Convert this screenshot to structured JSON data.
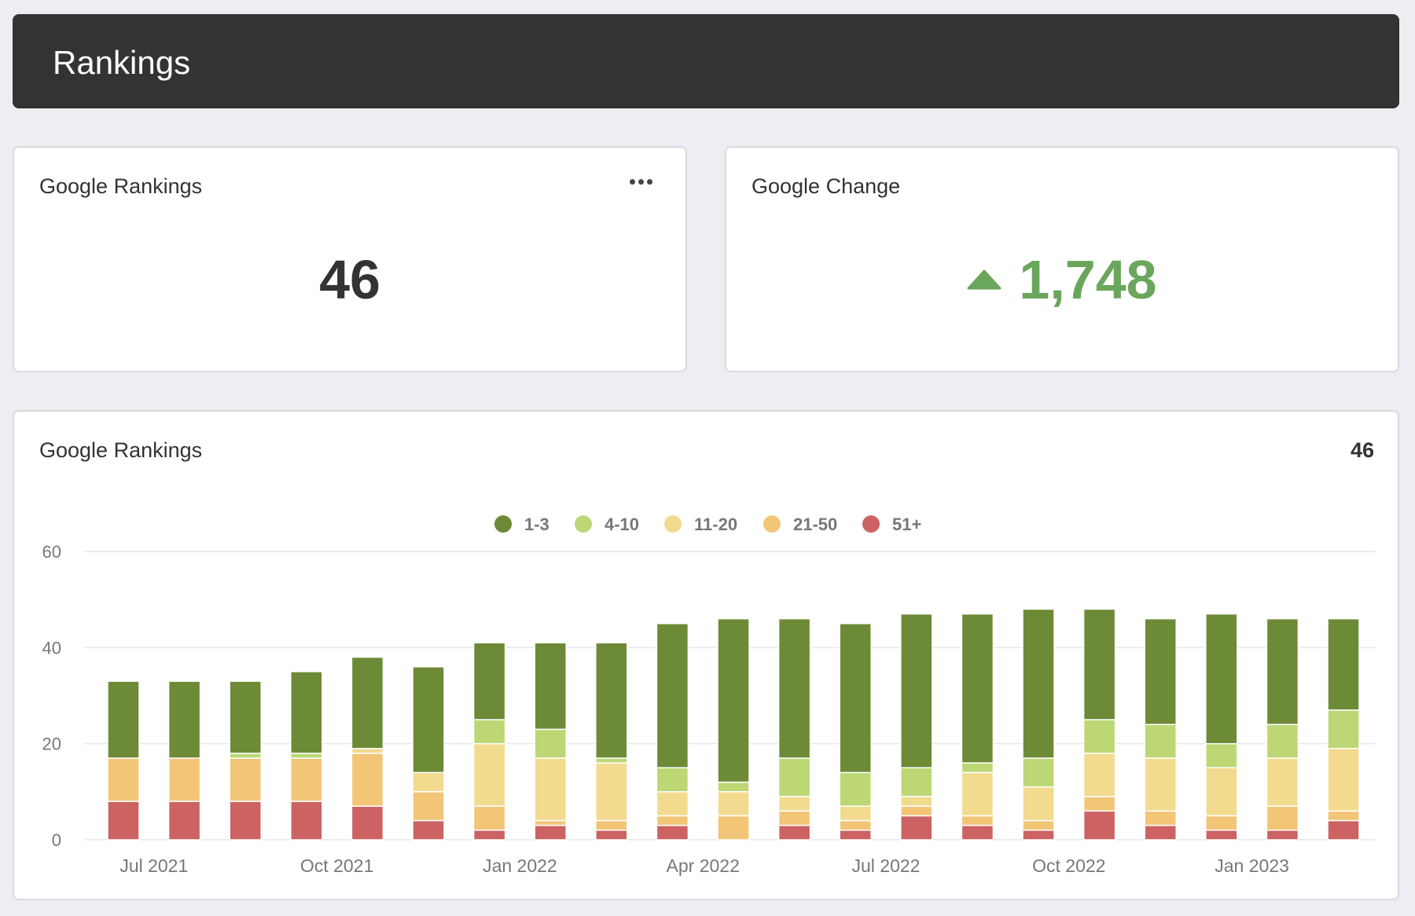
{
  "header": {
    "title": "Rankings"
  },
  "rankings_card": {
    "title": "Google Rankings",
    "value": "46",
    "menu_icon": "more-horizontal-icon"
  },
  "change_card": {
    "title": "Google Change",
    "value": "1,748",
    "direction_icon": "triangle-up-icon",
    "color": "#6aa65b"
  },
  "chart_card": {
    "title": "Google Rankings",
    "total": "46"
  },
  "chart_data": {
    "type": "bar",
    "stacked": true,
    "ylim": [
      0,
      60
    ],
    "yticks": [
      0,
      20,
      40,
      60
    ],
    "xtick_labels": [
      "Jul 2021",
      "Oct 2021",
      "Jan 2022",
      "Apr 2022",
      "Jul 2022",
      "Oct 2022",
      "Jan 2023"
    ],
    "xtick_after_bar": [
      0.5,
      3.5,
      6.5,
      9.5,
      12.5,
      15.5,
      18.5
    ],
    "legend_position": "top-center",
    "grid": true,
    "series": [
      {
        "name": "51+",
        "color": "#cc6262",
        "values": [
          8,
          8,
          8,
          8,
          7,
          4,
          2,
          3,
          2,
          3,
          0,
          3,
          2,
          5,
          3,
          2,
          6,
          3,
          2,
          2,
          4
        ]
      },
      {
        "name": "21-50",
        "color": "#f2c577",
        "values": [
          9,
          9,
          9,
          9,
          11,
          6,
          5,
          1,
          2,
          2,
          5,
          3,
          2,
          2,
          2,
          2,
          3,
          3,
          3,
          5,
          2
        ]
      },
      {
        "name": "11-20",
        "color": "#f2db8e",
        "values": [
          0,
          0,
          0,
          0,
          1,
          4,
          13,
          13,
          12,
          5,
          5,
          3,
          3,
          2,
          9,
          7,
          9,
          11,
          10,
          10,
          13
        ]
      },
      {
        "name": "4-10",
        "color": "#bcd774",
        "values": [
          0,
          0,
          1,
          1,
          0,
          0,
          5,
          6,
          1,
          5,
          2,
          8,
          7,
          6,
          2,
          6,
          7,
          7,
          5,
          7,
          8
        ]
      },
      {
        "name": "1-3",
        "color": "#6d8a36",
        "values": [
          16,
          16,
          15,
          17,
          19,
          22,
          16,
          18,
          24,
          30,
          34,
          29,
          31,
          32,
          31,
          31,
          23,
          22,
          27,
          22,
          19
        ]
      }
    ],
    "legend_order": [
      "1-3",
      "4-10",
      "11-20",
      "21-50",
      "51+"
    ]
  }
}
